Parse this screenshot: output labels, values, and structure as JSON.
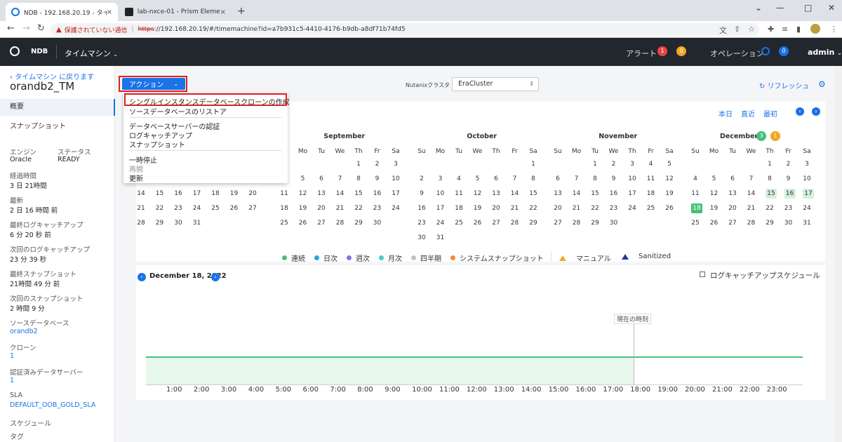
{
  "browser": {
    "tabs": [
      {
        "title": "NDB - 192.168.20.19 - タイムマシン",
        "close": "×"
      },
      {
        "title": "lab-nxce-01 - Prism Element",
        "close": "×"
      }
    ],
    "new_tab": "+",
    "not_secure": "保護されていない通信",
    "url_scheme": "https",
    "url_rest": "://192.168.20.19/#/timemachine?id=a7b931c5-4410-4176-b9db-a8df71b74fd5"
  },
  "header": {
    "app_name": "NDB",
    "nav": "タイムマシン",
    "alerts_label": "アラート",
    "alerts_red": "1",
    "alerts_yellow": "0",
    "ops_label": "オペレーション",
    "ops_count": "0",
    "user": "admin"
  },
  "sidebar": {
    "back": "タイムマシン に戻ります",
    "name": "orandb2_TM",
    "nav": [
      "概要",
      "スナップショット"
    ],
    "engine_label": "エンジン",
    "engine": "Oracle",
    "status_label": "ステータス",
    "status": "READY",
    "fields": [
      {
        "label": "経過時間",
        "value": "3 日 21時間"
      },
      {
        "label": "最新",
        "value": "2 日 16 時間 前"
      },
      {
        "label": "最終ログキャッチアップ",
        "value": "6 分 20 秒 前"
      },
      {
        "label": "次回のログキャッチアップ",
        "value": "23 分 39 秒"
      },
      {
        "label": "最終スナップショット",
        "value": "21時間 49 分 前"
      },
      {
        "label": "次回のスナップショット",
        "value": "2 時間 9 分"
      }
    ],
    "links": [
      {
        "label": "ソースデータベース",
        "value": "orandb2"
      },
      {
        "label": "クローン",
        "value": "1"
      },
      {
        "label": "認証済みデータサーバー",
        "value": "1"
      },
      {
        "label": "SLA",
        "value": "DEFAULT_OOB_GOLD_SLA"
      }
    ],
    "schedule": "スケジュール",
    "tags": "タグ"
  },
  "toolbar": {
    "action": "アクション",
    "cluster_label": "Nutanixクラスタ",
    "cluster_value": "EraCluster",
    "refresh": "リフレッシュ"
  },
  "action_menu": {
    "items": [
      "シングルインスタンスデータベースクローンの作成",
      "ソースデータベースのリストア",
      "データベースサーバーの認証",
      "ログキャッチアップ",
      "スナップショット",
      "一時停止",
      "再開",
      "更新"
    ]
  },
  "calendar": {
    "today": "本日",
    "recent": "直近",
    "first": "最初",
    "dow": [
      "Su",
      "Mo",
      "Tu",
      "We",
      "Th",
      "Fr",
      "Sa"
    ],
    "months": [
      {
        "name": "September",
        "rows": [
          [
            "",
            "",
            "",
            "",
            "1",
            "2",
            "3"
          ],
          [
            "4",
            "5",
            "6",
            "7",
            "8",
            "9",
            "10"
          ],
          [
            "11",
            "12",
            "13",
            "14",
            "15",
            "16",
            "17"
          ],
          [
            "18",
            "19",
            "20",
            "21",
            "22",
            "23",
            "24"
          ],
          [
            "25",
            "26",
            "27",
            "28",
            "29",
            "30",
            ""
          ]
        ]
      },
      {
        "name": "October",
        "rows": [
          [
            "",
            "",
            "",
            "",
            "",
            "",
            "1"
          ],
          [
            "2",
            "3",
            "4",
            "5",
            "6",
            "7",
            "8"
          ],
          [
            "9",
            "10",
            "11",
            "12",
            "13",
            "14",
            "15"
          ],
          [
            "16",
            "17",
            "18",
            "19",
            "20",
            "21",
            "22"
          ],
          [
            "23",
            "24",
            "25",
            "26",
            "27",
            "28",
            "29"
          ],
          [
            "30",
            "31",
            "",
            "",
            "",
            "",
            ""
          ]
        ]
      },
      {
        "name": "November",
        "rows": [
          [
            "",
            "",
            "1",
            "2",
            "3",
            "4",
            "5"
          ],
          [
            "6",
            "7",
            "8",
            "9",
            "10",
            "11",
            "12"
          ],
          [
            "13",
            "14",
            "15",
            "16",
            "17",
            "18",
            "19"
          ],
          [
            "20",
            "21",
            "22",
            "23",
            "24",
            "25",
            "26"
          ],
          [
            "27",
            "28",
            "29",
            "30",
            "",
            "",
            ""
          ]
        ]
      },
      {
        "name": "December",
        "badge_green": "3",
        "badge_yellow": "1",
        "rows": [
          [
            "",
            "",
            "",
            "",
            "1",
            "2",
            "3"
          ],
          [
            "4",
            "5",
            "6",
            "7",
            "8",
            "9",
            "10"
          ],
          [
            "11",
            "12",
            "13",
            "14",
            "15",
            "16",
            "17"
          ],
          [
            "18",
            "19",
            "20",
            "21",
            "22",
            "23",
            "24"
          ],
          [
            "25",
            "26",
            "27",
            "28",
            "29",
            "30",
            "31"
          ]
        ]
      }
    ],
    "partial_august_rows": [
      [
        "14",
        "15",
        "16",
        "17",
        "18",
        "19",
        "20"
      ],
      [
        "21",
        "22",
        "23",
        "24",
        "25",
        "26",
        "27"
      ],
      [
        "28",
        "29",
        "30",
        "31",
        "",
        "",
        ""
      ]
    ],
    "partial_august_row2_tail": [
      "4",
      "5",
      "6",
      "7",
      "8",
      "9",
      "10"
    ]
  },
  "legend": [
    "連続",
    "日次",
    "週次",
    "月次",
    "四半期",
    "システムスナップショット",
    "マニュアル",
    "Sanitized"
  ],
  "timeline": {
    "date": "December 18, 2022",
    "checkbox_label": "ログキャッチアップスケジュール",
    "now_label": "現在の時刻",
    "hours": [
      "1:00",
      "2:00",
      "3:00",
      "4:00",
      "5:00",
      "6:00",
      "7:00",
      "8:00",
      "9:00",
      "10:00",
      "11:00",
      "12:00",
      "13:00",
      "14:00",
      "15:00",
      "16:00",
      "17:00",
      "18:00",
      "19:00",
      "20:00",
      "21:00",
      "22:00",
      "23:00"
    ]
  }
}
